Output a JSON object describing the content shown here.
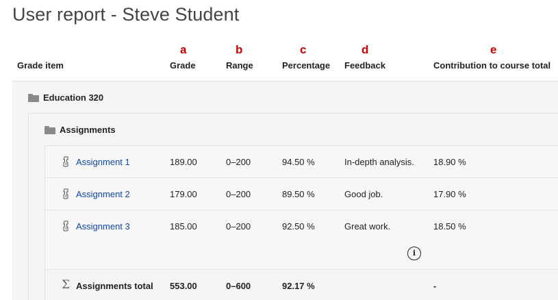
{
  "page": {
    "title": "User report - Steve Student"
  },
  "annotations": [
    "a",
    "b",
    "c",
    "d",
    "e"
  ],
  "columns": {
    "grade_item": "Grade item",
    "grade": "Grade",
    "range": "Range",
    "percentage": "Percentage",
    "feedback": "Feedback",
    "contribution": "Contribution to course total"
  },
  "course": {
    "name": "Education 320",
    "icon": "folder-icon"
  },
  "category": {
    "name": "Assignments",
    "icon": "folder-icon"
  },
  "items": [
    {
      "name": "Assignment 1",
      "grade": "189.00",
      "range": "0–200",
      "percentage": "94.50 %",
      "feedback": "In-depth analysis.",
      "contribution": "18.90 %"
    },
    {
      "name": "Assignment 2",
      "grade": "179.00",
      "range": "0–200",
      "percentage": "89.50 %",
      "feedback": "Good job.",
      "contribution": "17.90 %"
    },
    {
      "name": "Assignment 3",
      "grade": "185.00",
      "range": "0–200",
      "percentage": "92.50 %",
      "feedback": "Great work.",
      "contribution": "18.50 %"
    }
  ],
  "info_icon": "i",
  "total": {
    "name": "Assignments total",
    "grade": "553.00",
    "range": "0–600",
    "percentage": "92.17 %",
    "contribution": "-"
  }
}
